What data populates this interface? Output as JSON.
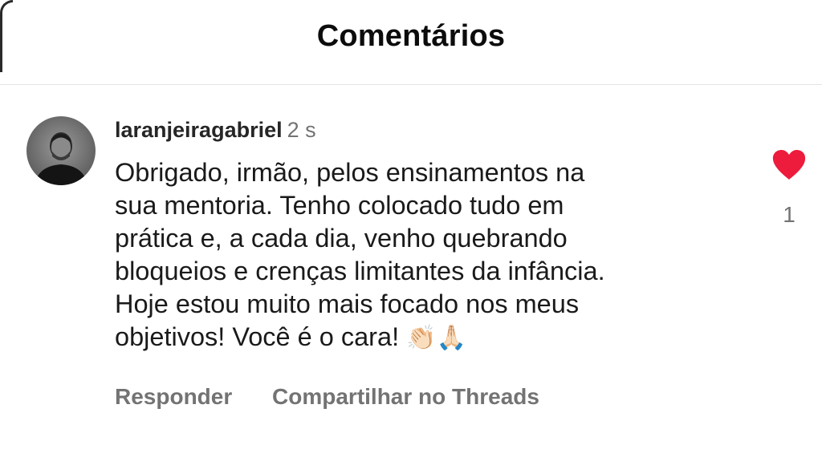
{
  "header": {
    "title": "Comentários"
  },
  "comment": {
    "avatar_icon": "avatar",
    "username": "laranjeiragabriel",
    "timestamp": "2 s",
    "text_lines": [
      "Obrigado, irmão, pelos ensinamentos na",
      "sua mentoria. Tenho colocado tudo em",
      "prática e, a cada dia, venho quebrando",
      "bloqueios e crenças limitantes da infância.",
      "Hoje estou muito mais focado nos meus",
      "objetivos! Você é o cara!"
    ],
    "emojis": [
      "👏🏻",
      "🙏🏻"
    ],
    "like_icon": "heart-icon",
    "like_color": "#ed1b3c",
    "like_count": "1",
    "actions": {
      "reply_label": "Responder",
      "share_label": "Compartilhar no Threads"
    }
  }
}
